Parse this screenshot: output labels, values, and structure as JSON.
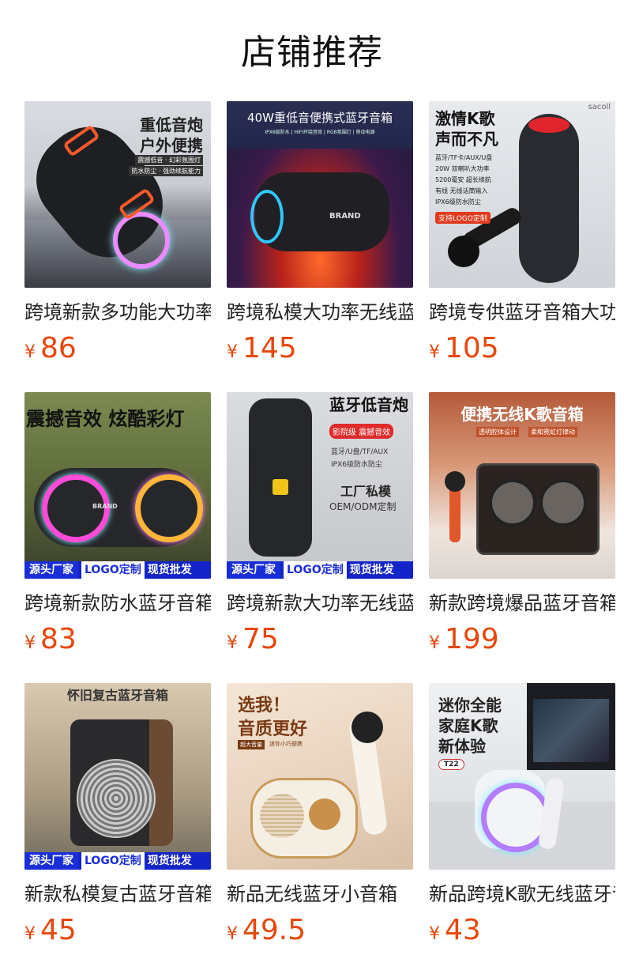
{
  "section": {
    "title": "店铺推荐"
  },
  "currency": "¥",
  "products": [
    {
      "name": "跨境新款多功能大功率户外便携蓝牙音箱",
      "price": "86",
      "image_text": [
        "重低音炮",
        "户外便携",
        "震撼低音 · 幻彩氛围灯",
        "防水防尘 · 强劲续航能力"
      ]
    },
    {
      "name": "跨境私模大功率无线蓝牙音箱",
      "price": "145",
      "image_text": [
        "40W重低音便携式蓝牙音箱",
        "IPX6级防水 | HIFI环绕音效 | RGB氛围灯 | 移动电源",
        "BRAND"
      ]
    },
    {
      "name": "跨境专供蓝牙音箱大功率",
      "price": "105",
      "image_text": [
        "激情K歌",
        "声而不凡",
        "蓝牙/TF卡/AUX/U盘",
        "20W 双喇叭大功率",
        "5200毫安 超长续航",
        "有线 无线话筒输入",
        "IPX6级防水防尘",
        "支持LOGO定制",
        "sacoll"
      ]
    },
    {
      "name": "跨境新款防水蓝牙音箱",
      "price": "83",
      "image_text": [
        "震撼音效 炫酷彩灯",
        "BRAND",
        "源头厂家",
        "LOGO定制",
        "现货批发"
      ]
    },
    {
      "name": "跨境新款大功率无线蓝牙音箱",
      "price": "75",
      "image_text": [
        "蓝牙低音炮",
        "影院级",
        "震撼音效",
        "蓝牙/U盘/TF/AUX",
        "IPX6级防水防尘",
        "工厂私模",
        "OEM/ODM定制",
        "源头厂家",
        "LOGO定制",
        "现货批发"
      ]
    },
    {
      "name": "新款跨境爆品蓝牙音箱",
      "price": "199",
      "image_text": [
        "便携无线K歌音箱",
        "透明腔体设计",
        "柔和霓虹灯律动"
      ]
    },
    {
      "name": "新款私模复古蓝牙音箱",
      "price": "45",
      "image_text": [
        "怀旧复古蓝牙音箱",
        "源头厂家",
        "LOGO定制",
        "现货批发"
      ]
    },
    {
      "name": "新品无线蓝牙小音箱",
      "price": "49.5",
      "image_text": [
        "选我！",
        "音质更好",
        "超大音量",
        "迷你小巧便携"
      ]
    },
    {
      "name": "新品跨境K歌无线蓝牙音箱",
      "price": "43",
      "image_text": [
        "迷你全能",
        "家庭K歌",
        "新体验",
        "T22"
      ]
    }
  ]
}
